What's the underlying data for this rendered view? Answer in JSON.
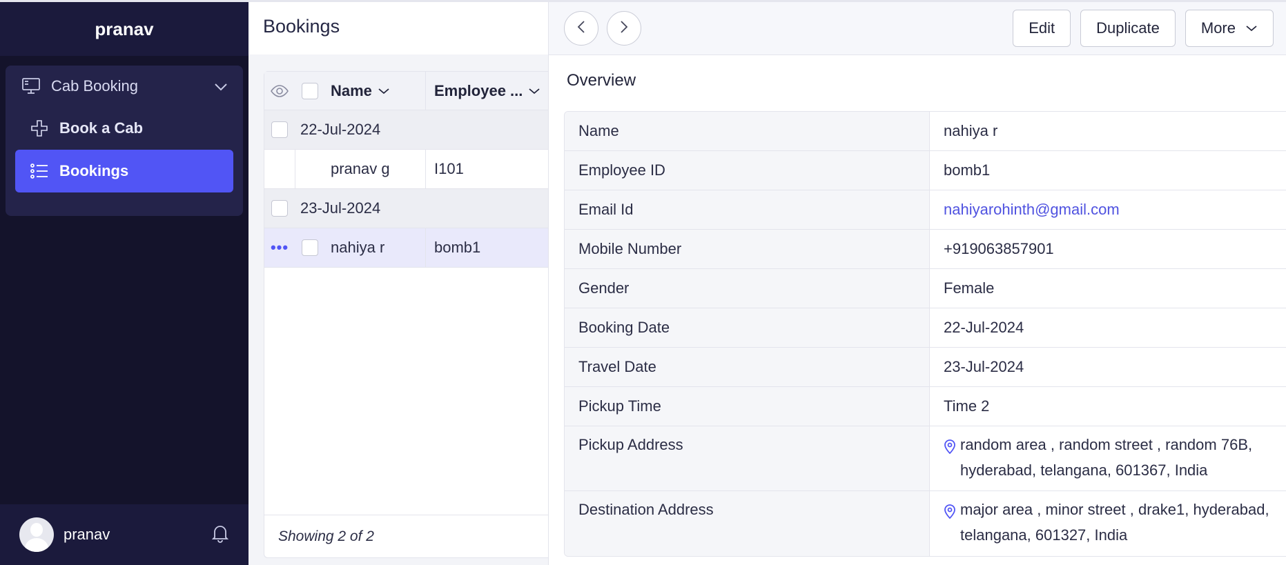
{
  "sidebar": {
    "workspace": "pranav",
    "group": {
      "label": "Cab Booking",
      "icon": "monitor-icon"
    },
    "items": [
      {
        "label": "Book a Cab",
        "icon": "plus-icon",
        "active": false
      },
      {
        "label": "Bookings",
        "icon": "list-icon",
        "active": true
      }
    ],
    "user": {
      "name": "pranav"
    }
  },
  "list": {
    "title": "Bookings",
    "columns": {
      "name": "Name",
      "employee": "Employee ..."
    },
    "groups": [
      {
        "label": "22-Jul-2024",
        "rows": [
          {
            "name": "pranav g",
            "employee_id": "I101"
          }
        ]
      },
      {
        "label": "23-Jul-2024",
        "rows": [
          {
            "name": "nahiya r",
            "employee_id": "bomb1"
          }
        ]
      }
    ],
    "footer": "Showing 2 of 2"
  },
  "detail": {
    "buttons": {
      "edit": "Edit",
      "duplicate": "Duplicate",
      "more": "More"
    },
    "section_title": "Overview",
    "fields": [
      {
        "key": "Name",
        "value": "nahiya r"
      },
      {
        "key": "Employee ID",
        "value": "bomb1"
      },
      {
        "key": "Email Id",
        "value": "nahiyarohinth@gmail.com"
      },
      {
        "key": "Mobile Number",
        "value": "+919063857901"
      },
      {
        "key": "Gender",
        "value": "Female"
      },
      {
        "key": "Booking Date",
        "value": "22-Jul-2024"
      },
      {
        "key": "Travel Date",
        "value": "23-Jul-2024"
      },
      {
        "key": "Pickup Time",
        "value": "Time 2"
      },
      {
        "key": "Pickup Address",
        "value": "random area , random street , random 76B, hyderabad, telangana, 601367, India"
      },
      {
        "key": "Destination Address",
        "value": "major area , minor street , drake1, hyderabad, telangana, 601327, India"
      }
    ]
  },
  "colors": {
    "accent": "#5155f5",
    "sidebar_bg": "#14132b",
    "link": "#4f52e0"
  }
}
